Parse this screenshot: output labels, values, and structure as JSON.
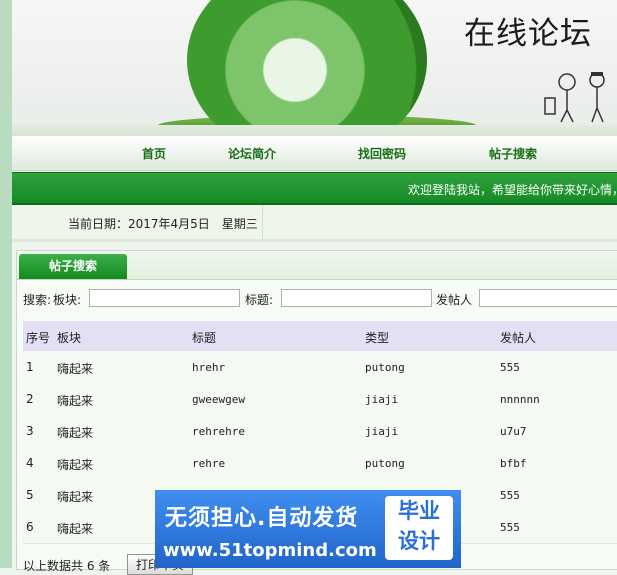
{
  "banner": {
    "title": "在线论坛"
  },
  "nav": {
    "items": [
      "首页",
      "论坛简介",
      "找回密码",
      "帖子搜索"
    ]
  },
  "welcome": {
    "text": "欢迎登陆我站，希望能给你带来好心情，"
  },
  "date": {
    "text": "当前日期：2017年4月5日　星期三"
  },
  "panel": {
    "tab": "帖子搜索"
  },
  "search": {
    "prefix": "搜索:",
    "board_label": "板块:",
    "title_label": "标题:",
    "poster_label": "发帖人",
    "board_value": "",
    "title_value": "",
    "poster_value": ""
  },
  "table": {
    "headers": [
      "序号",
      "板块",
      "标题",
      "类型",
      "发帖人"
    ],
    "rows": [
      [
        "1",
        "嗨起来",
        "hrehr",
        "putong",
        "555"
      ],
      [
        "2",
        "嗨起来",
        "gweewgew",
        "jiaji",
        "nnnnnn"
      ],
      [
        "3",
        "嗨起来",
        "rehrehre",
        "jiaji",
        "u7u7"
      ],
      [
        "4",
        "嗨起来",
        "rehre",
        "putong",
        "bfbf"
      ],
      [
        "5",
        "嗨起来",
        "",
        "",
        "555"
      ],
      [
        "6",
        "嗨起来",
        "",
        "",
        "555"
      ]
    ]
  },
  "footer": {
    "text": "以上数据共 6 条",
    "print_label": "打印本页"
  },
  "watermark": {
    "line1": "无须担心.自动发货",
    "line2": "www.51topmind.com",
    "badge1": "毕业",
    "badge2": "设计"
  }
}
